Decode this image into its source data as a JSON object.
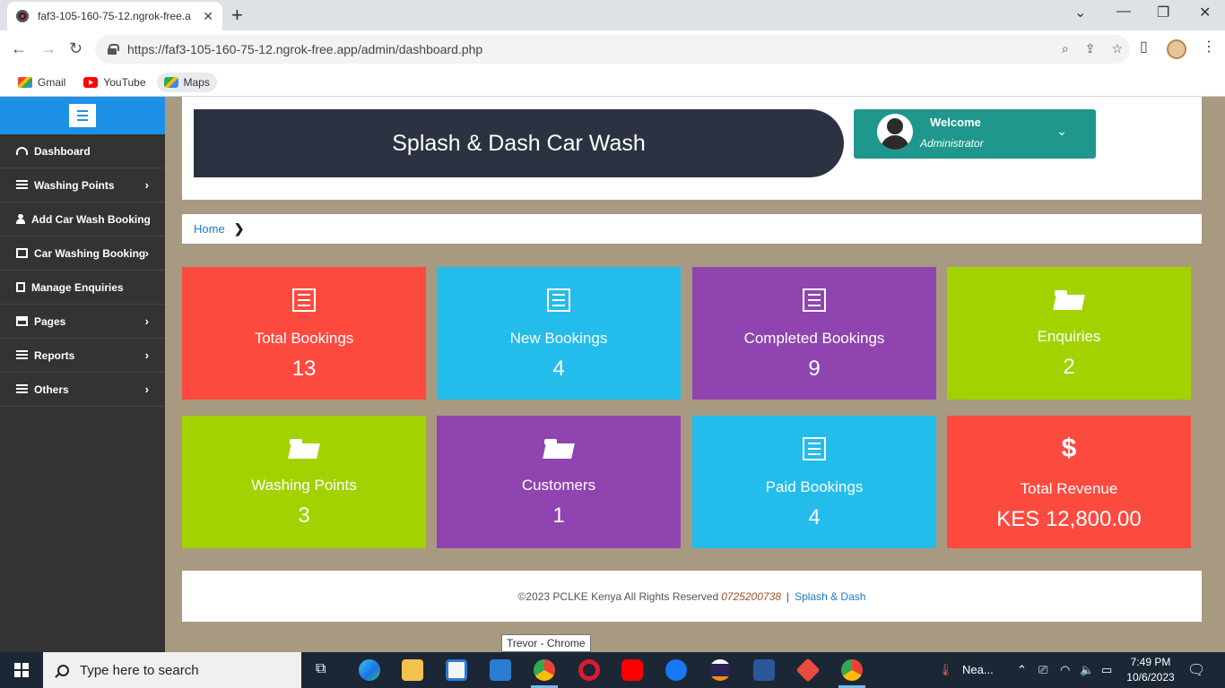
{
  "browser": {
    "tab_title": "faf3-105-160-75-12.ngrok-free.a",
    "url": "https://faf3-105-160-75-12.ngrok-free.app/admin/dashboard.php",
    "bookmarks": [
      {
        "label": "Gmail"
      },
      {
        "label": "YouTube"
      },
      {
        "label": "Maps"
      }
    ]
  },
  "sidebar": {
    "items": [
      {
        "label": "Dashboard",
        "icon": "dashboard-icon",
        "has_submenu": false
      },
      {
        "label": "Washing Points",
        "icon": "list-icon",
        "has_submenu": true
      },
      {
        "label": "Add Car Wash Booking",
        "icon": "user-icon",
        "has_submenu": false
      },
      {
        "label": "Car Washing Booking",
        "icon": "edit-icon",
        "has_submenu": true
      },
      {
        "label": "Manage Enquiries",
        "icon": "file-icon",
        "has_submenu": false
      },
      {
        "label": "Pages",
        "icon": "pages-icon",
        "has_submenu": true
      },
      {
        "label": "Reports",
        "icon": "list-icon",
        "has_submenu": true
      },
      {
        "label": "Others",
        "icon": "list-ol-icon",
        "has_submenu": true
      }
    ]
  },
  "header": {
    "brand": "Splash & Dash Car Wash",
    "welcome_title": "Welcome",
    "welcome_role": "Administrator"
  },
  "breadcrumb": {
    "home": "Home",
    "separator": "❯"
  },
  "cards": [
    {
      "label": "Total Bookings",
      "value": "13",
      "color": "#fd4a3f",
      "icon": "form-icon"
    },
    {
      "label": "New Bookings",
      "value": "4",
      "color": "#24bceb",
      "icon": "form-icon"
    },
    {
      "label": "Completed Bookings",
      "value": "9",
      "color": "#8f44b0",
      "icon": "form-icon"
    },
    {
      "label": "Enquiries",
      "value": "2",
      "color": "#a2d200",
      "icon": "folder-open-icon"
    },
    {
      "label": "Washing Points",
      "value": "3",
      "color": "#a2d200",
      "icon": "folder-open-icon"
    },
    {
      "label": "Customers",
      "value": "1",
      "color": "#8f44b0",
      "icon": "folder-open-icon"
    },
    {
      "label": "Paid Bookings",
      "value": "4",
      "color": "#24bceb",
      "icon": "form-icon"
    },
    {
      "label": "Total Revenue",
      "value": "KES 12,800.00",
      "color": "#fd4a3f",
      "icon": "dollar-icon"
    }
  ],
  "footer": {
    "copyright": "©2023 PCLKE Kenya All Rights Reserved",
    "phone": "0725200738",
    "separator": "|",
    "link": "Splash & Dash"
  },
  "tooltip": "Trevor - Chrome",
  "taskbar": {
    "search_placeholder": "Type here to search",
    "weather": "Nea...",
    "time": "7:49 PM",
    "date": "10/6/2023"
  }
}
